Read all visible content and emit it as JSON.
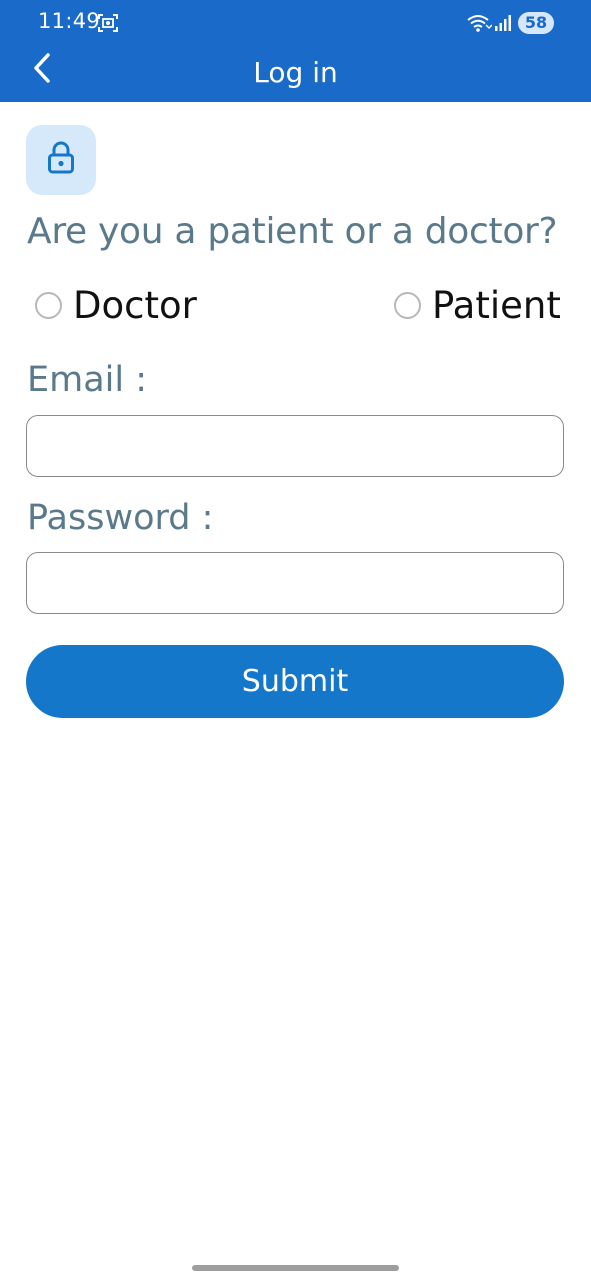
{
  "status_bar": {
    "time": "11:49",
    "battery": "58"
  },
  "app_bar": {
    "title": "Log in"
  },
  "icons": {
    "back": "chevron-left-icon",
    "lock": "lock-icon",
    "screenshot": "screenshot-icon",
    "wifi": "wifi-icon",
    "signal": "signal-icon"
  },
  "form": {
    "question": "Are you a patient or a doctor?",
    "role_options": [
      {
        "label": "Doctor",
        "selected": false
      },
      {
        "label": "Patient",
        "selected": false
      }
    ],
    "email_label": "Email :",
    "email_value": "",
    "password_label": "Password :",
    "password_value": "",
    "submit_label": "Submit"
  },
  "colors": {
    "primary": "#1a6ac9",
    "button": "#1577c9",
    "label_text": "#5a7a8c",
    "lock_badge_bg": "#d6e9fb"
  }
}
